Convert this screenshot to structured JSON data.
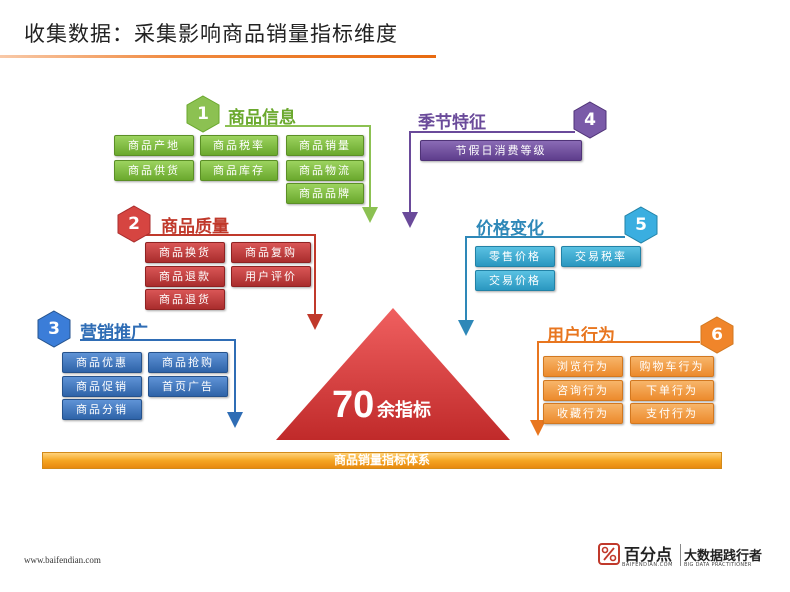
{
  "title": "收集数据：采集影响商品销量指标维度",
  "groups": [
    {
      "num": "1",
      "title": "商品信息",
      "color": "#7bb93e",
      "items": [
        "商品产地",
        "商品税率",
        "商品销量",
        "商品供货",
        "商品库存",
        "商品物流",
        "商品品牌"
      ]
    },
    {
      "num": "2",
      "title": "商品质量",
      "color": "#c0392b",
      "items": [
        "商品换货",
        "商品复购",
        "商品退款",
        "用户评价",
        "商品退货"
      ]
    },
    {
      "num": "3",
      "title": "营销推广",
      "color": "#2f6db5",
      "items": [
        "商品优惠",
        "商品抢购",
        "商品促销",
        "首页广告",
        "商品分销"
      ]
    },
    {
      "num": "4",
      "title": "季节特征",
      "color": "#6a4a9a",
      "items": [
        "节假日消费等级"
      ]
    },
    {
      "num": "5",
      "title": "价格变化",
      "color": "#2e88b8",
      "items": [
        "零售价格",
        "交易税率",
        "交易价格"
      ]
    },
    {
      "num": "6",
      "title": "用户行为",
      "color": "#e8761f",
      "items": [
        "浏览行为",
        "购物车行为",
        "咨询行为",
        "下单行为",
        "收藏行为",
        "支付行为"
      ]
    }
  ],
  "pyramid": {
    "number": "70",
    "suffix": "余指标"
  },
  "base_bar": "商品销量指标体系",
  "footer": {
    "url": "www.baifendian.com",
    "brand_name": "百分点",
    "brand_url": "BAIFENDIAN.COM",
    "slogan": "大数据践行者",
    "slogan_sub": "BIG DATA PRACTITIONER"
  }
}
